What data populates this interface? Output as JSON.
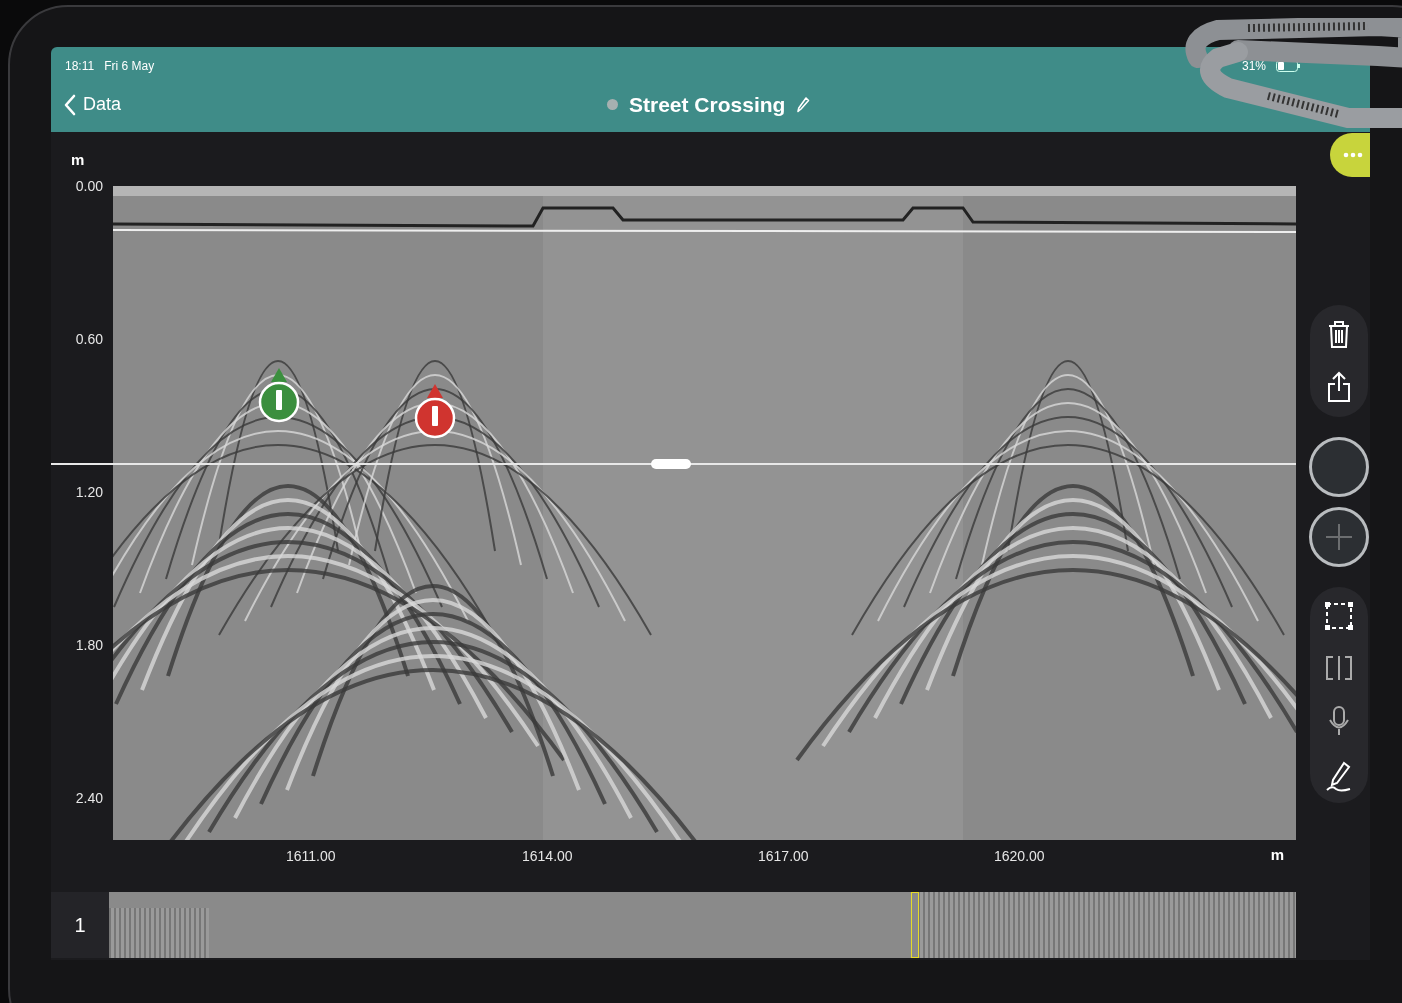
{
  "status_bar": {
    "time": "18:11",
    "date": "Fri 6 May",
    "battery": "31%"
  },
  "nav": {
    "back": "Data",
    "title": "Street Crossing"
  },
  "plot": {
    "y_unit": "m",
    "y_ticks": [
      "0.00",
      "0.60",
      "1.20",
      "1.80",
      "2.40"
    ],
    "x_unit": "m",
    "x_ticks": [
      "1611.00",
      "1614.00",
      "1617.00",
      "1620.00"
    ],
    "markers": [
      {
        "color": "#3b8f3e"
      },
      {
        "color": "#d0342f"
      }
    ]
  },
  "minimap": {
    "track": "1"
  }
}
